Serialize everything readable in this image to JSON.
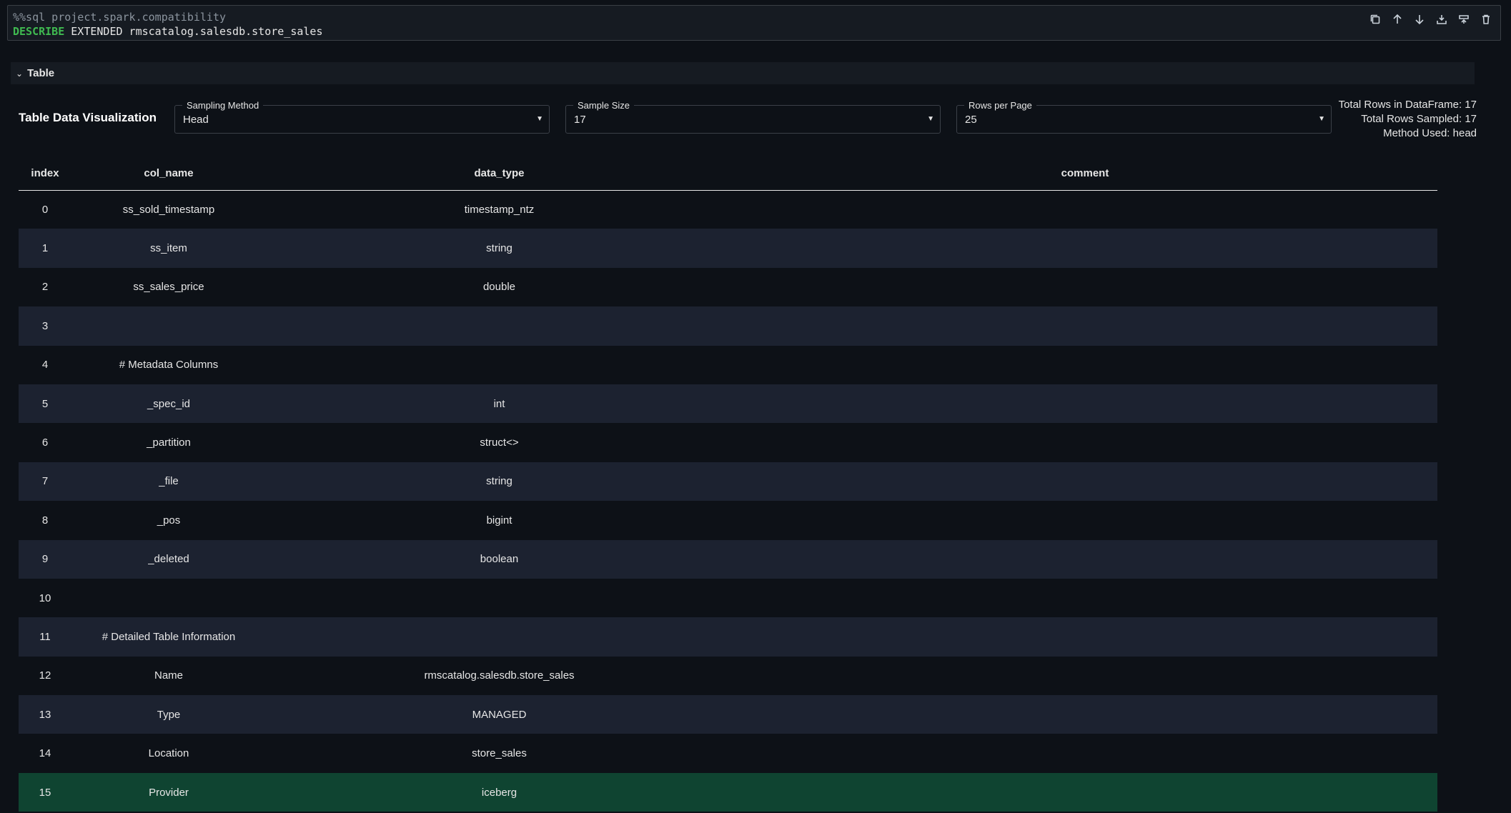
{
  "cell": {
    "magic": "%%sql project.spark.compatibility",
    "keyword": "DESCRIBE",
    "rest": "EXTENDED rmscatalog.salesdb.store_sales",
    "toolbar": [
      "copy-icon",
      "arrow-up-icon",
      "arrow-down-icon",
      "insert-below-icon",
      "insert-above-icon",
      "trash-icon"
    ]
  },
  "section": {
    "title": "Table"
  },
  "viz": {
    "title": "Table Data Visualization",
    "sampling": {
      "label": "Sampling Method",
      "value": "Head"
    },
    "sample_size": {
      "label": "Sample Size",
      "value": "17"
    },
    "rows_per_page": {
      "label": "Rows per Page",
      "value": "25"
    },
    "stats": {
      "total_rows": "Total Rows in DataFrame: 17",
      "rows_sampled": "Total Rows Sampled: 17",
      "method": "Method Used: head"
    }
  },
  "table": {
    "headers": [
      "index",
      "col_name",
      "data_type",
      "comment"
    ],
    "rows": [
      [
        "0",
        "ss_sold_timestamp",
        "timestamp_ntz",
        ""
      ],
      [
        "1",
        "ss_item",
        "string",
        ""
      ],
      [
        "2",
        "ss_sales_price",
        "double",
        ""
      ],
      [
        "3",
        "",
        "",
        ""
      ],
      [
        "4",
        "# Metadata Columns",
        "",
        ""
      ],
      [
        "5",
        "_spec_id",
        "int",
        ""
      ],
      [
        "6",
        "_partition",
        "struct<>",
        ""
      ],
      [
        "7",
        "_file",
        "string",
        ""
      ],
      [
        "8",
        "_pos",
        "bigint",
        ""
      ],
      [
        "9",
        "_deleted",
        "boolean",
        ""
      ],
      [
        "10",
        "",
        "",
        ""
      ],
      [
        "11",
        "# Detailed Table Information",
        "",
        ""
      ],
      [
        "12",
        "Name",
        "rmscatalog.salesdb.store_sales",
        ""
      ],
      [
        "13",
        "Type",
        "MANAGED",
        ""
      ],
      [
        "14",
        "Location",
        "store_sales",
        ""
      ],
      [
        "15",
        "Provider",
        "iceberg",
        ""
      ]
    ],
    "selected_row": 15
  },
  "colors": {
    "selected_row": "#0f4431",
    "keyword": "#3fb950",
    "stripe": "#1c2230"
  }
}
